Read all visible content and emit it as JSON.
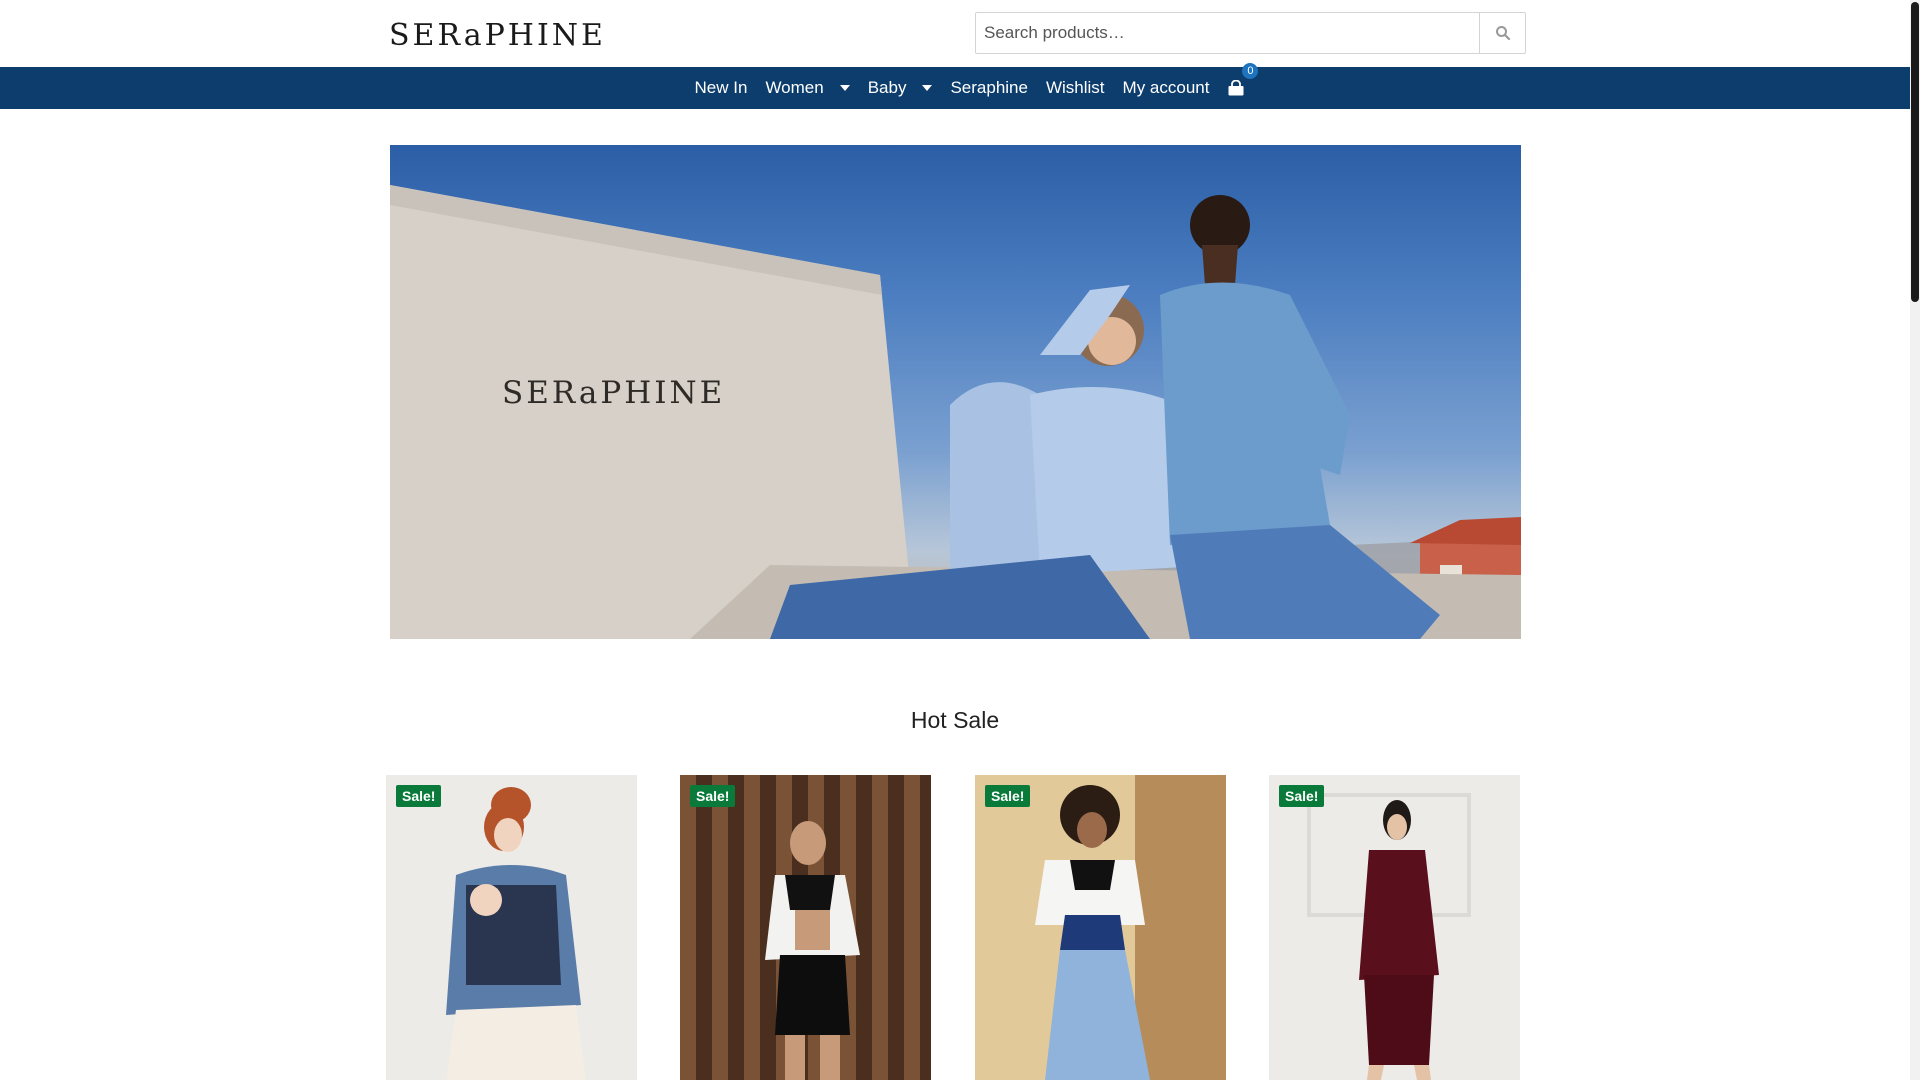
{
  "header": {
    "logo_text": "SERaPHINE",
    "search_placeholder": "Search products…"
  },
  "nav": {
    "items": [
      {
        "label": "New In",
        "has_dropdown": false
      },
      {
        "label": "Women",
        "has_dropdown": true
      },
      {
        "label": "Baby",
        "has_dropdown": true
      },
      {
        "label": "Seraphine",
        "has_dropdown": false
      },
      {
        "label": "Wishlist",
        "has_dropdown": false
      },
      {
        "label": "My account",
        "has_dropdown": false
      }
    ],
    "cart_count": "0",
    "cart_icon": "shopping-bag-icon",
    "colors": {
      "bar": "#0c3d6d",
      "badge": "#1e73be"
    }
  },
  "hero": {
    "logo_text": "SERaPHINE"
  },
  "section": {
    "title": "Hot Sale"
  },
  "products": [
    {
      "badge": "Sale!"
    },
    {
      "badge": "Sale!"
    },
    {
      "badge": "Sale!"
    },
    {
      "badge": "Sale!"
    }
  ],
  "colors": {
    "sale_badge": "#0a7a3a"
  }
}
